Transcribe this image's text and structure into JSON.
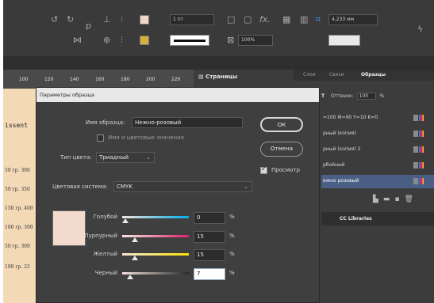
{
  "control_bar": {
    "font_size_value": "1 пт",
    "zoom_value": "100%",
    "width_value": "4,233 мм",
    "fx_label": "fx."
  },
  "ruler": {
    "ticks": [
      "100",
      "120",
      "140",
      "160",
      "180",
      "200",
      "220"
    ]
  },
  "pages_tab": {
    "label": "Страницы"
  },
  "swatches_panel": {
    "tabs": [
      "Слои",
      "Связи",
      "Образцы"
    ],
    "tint_label": "Оттенок:",
    "tint_value": "100",
    "tint_unit": "%",
    "items": [
      {
        "label": "=100 M=90 Y=10 K=0"
      },
      {
        "label": "рный (копия)"
      },
      {
        "label": "рный (копия) 2"
      },
      {
        "label": "рбойный"
      },
      {
        "label": "ежно розовый"
      }
    ],
    "cc_libraries_label": "CC Libraries"
  },
  "document": {
    "heading": "issent",
    "lines": [
      "50 гр. 300",
      "50 гр. 350",
      "150 гр. 400",
      "100 гр. 300",
      "50 гр. 300",
      "100 гр. 25"
    ]
  },
  "dialog": {
    "title": "Параметры образца",
    "swatch_name_label": "Имя образца:",
    "swatch_name_value": "Нежно-розовый",
    "name_with_value_label": "Имя и цветовые значения",
    "color_type_label": "Тип цвета:",
    "color_type_value": "Триадный",
    "color_mode_label": "Цветовая система:",
    "color_mode_value": "CMYK",
    "ok_label": "ОК",
    "cancel_label": "Отмена",
    "preview_label": "Просмотр",
    "preview_color": "#f2dacc",
    "channels": [
      {
        "label": "Голубой",
        "value": "0",
        "unit": "%",
        "fraction": 0.0,
        "track": "linear-gradient(90deg,#f2e2da,#00aee8)"
      },
      {
        "label": "Пурпурный",
        "value": "15",
        "unit": "%",
        "fraction": 0.15,
        "track": "linear-gradient(90deg,#f4e8e0,#e0206e)"
      },
      {
        "label": "Желтый",
        "value": "15",
        "unit": "%",
        "fraction": 0.15,
        "track": "linear-gradient(90deg,#f2e6d8,#ffe000)"
      },
      {
        "label": "Черный",
        "value": "7",
        "unit": "%",
        "fraction": 0.07,
        "track": "linear-gradient(90deg,#f2e2da,#2a2a2a)"
      }
    ]
  }
}
